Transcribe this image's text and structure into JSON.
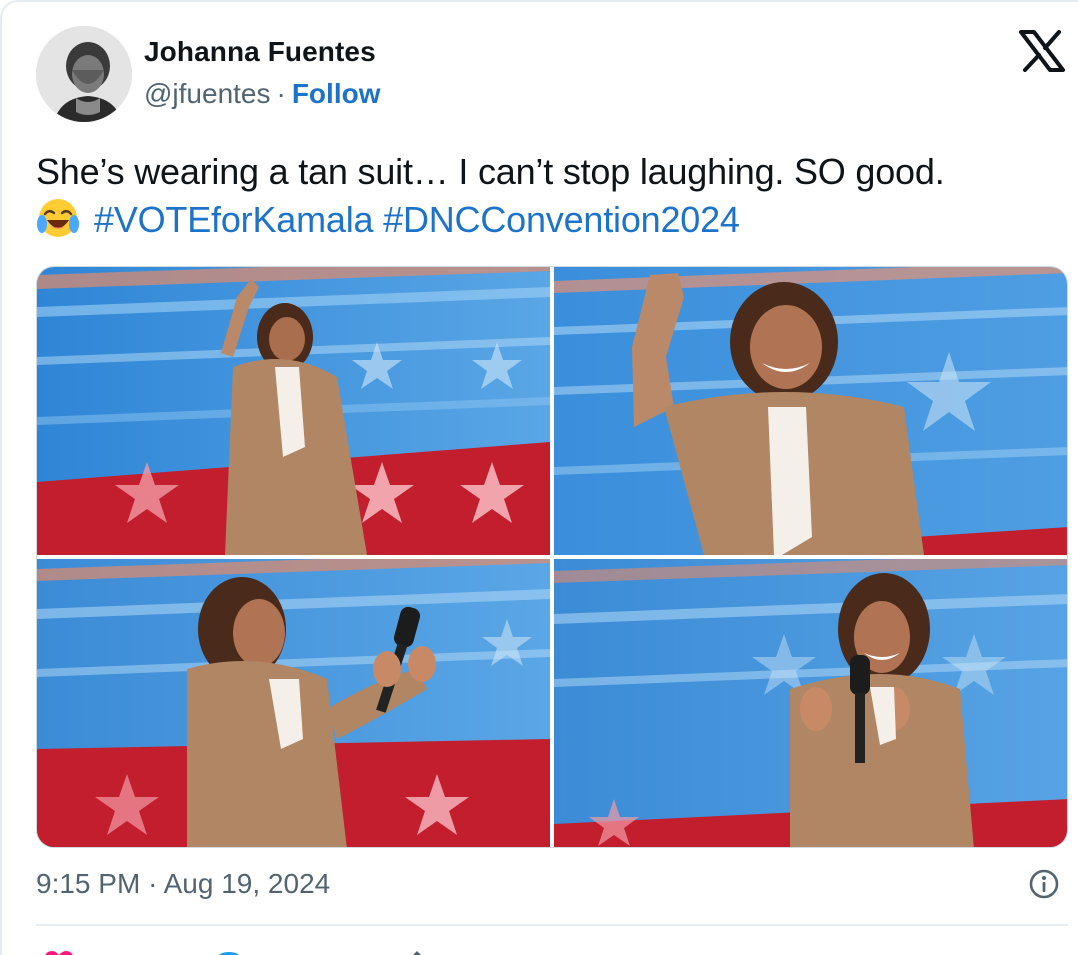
{
  "author": {
    "name": "Johanna Fuentes",
    "handle": "@jfuentes",
    "separator": "·",
    "follow_label": "Follow"
  },
  "brand_icon": "x-logo-icon",
  "tweet": {
    "line1": "She’s wearing a tan suit… I can’t stop laughing. SO good.",
    "emoji": "face-with-tears-of-joy-icon",
    "hashtags": [
      "#VOTEforKamala",
      "#DNCConvention2024"
    ]
  },
  "media": {
    "count": 4,
    "photos": [
      "photo-1",
      "photo-2",
      "photo-3",
      "photo-4"
    ]
  },
  "timestamp": {
    "time": "9:15 PM",
    "separator": "·",
    "date": "Aug 19, 2024"
  },
  "colors": {
    "link": "#1d73c9",
    "text": "#0f1419",
    "muted": "#536471",
    "like": "#f91880",
    "reply": "#1d9bf0",
    "divider": "#e6ecf0"
  }
}
